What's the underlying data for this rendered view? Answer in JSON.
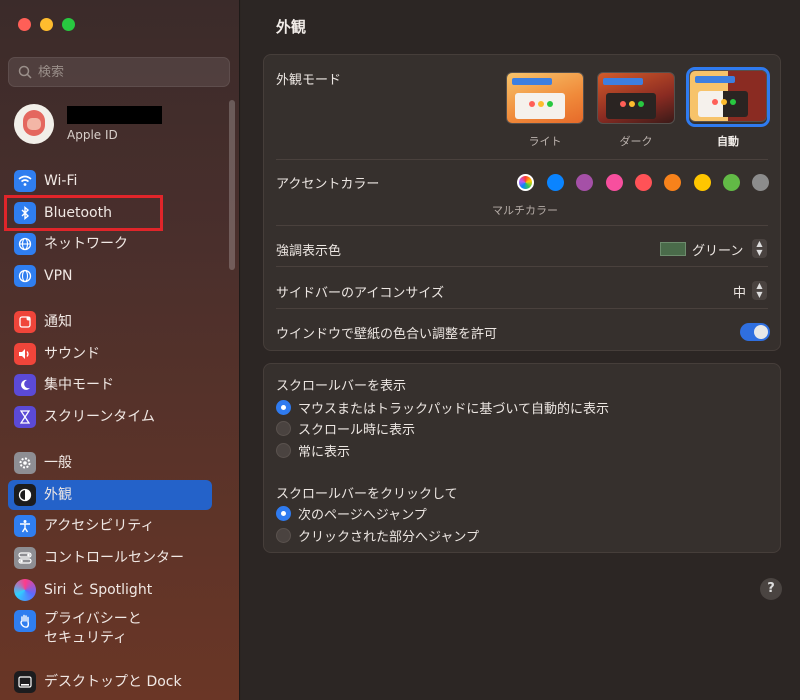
{
  "search": {
    "placeholder": "検索"
  },
  "account": {
    "subtitle": "Apple ID"
  },
  "sidebar": {
    "items": [
      {
        "label": "Wi-Fi"
      },
      {
        "label": "Bluetooth"
      },
      {
        "label": "ネットワーク"
      },
      {
        "label": "VPN"
      },
      {
        "label": "通知"
      },
      {
        "label": "サウンド"
      },
      {
        "label": "集中モード"
      },
      {
        "label": "スクリーンタイム"
      },
      {
        "label": "一般"
      },
      {
        "label": "外観"
      },
      {
        "label": "アクセシビリティ"
      },
      {
        "label": "コントロールセンター"
      },
      {
        "label": "Siri と Spotlight"
      },
      {
        "label": "プライバシーと\nセキュリティ"
      },
      {
        "label": "デスクトップと Dock"
      }
    ]
  },
  "main": {
    "title": "外観",
    "appearance": {
      "label": "外観モード",
      "options": [
        {
          "label": "ライト"
        },
        {
          "label": "ダーク"
        },
        {
          "label": "自動"
        }
      ],
      "selected": "自動"
    },
    "accent": {
      "label": "アクセントカラー",
      "multicolor_label": "マルチカラー",
      "colors": [
        "#0a84ff",
        "#a550a7",
        "#f74f9e",
        "#ff5257",
        "#f7821b",
        "#ffc600",
        "#62ba46",
        "#8c8c8c"
      ]
    },
    "highlight": {
      "label": "強調表示色",
      "value": "グリーン"
    },
    "sidebar_icon_size": {
      "label": "サイドバーのアイコンサイズ",
      "value": "中"
    },
    "wallpaper_tint": {
      "label": "ウインドウで壁紙の色合い調整を許可",
      "enabled": true
    },
    "show_scrollbars": {
      "title": "スクロールバーを表示",
      "options": [
        {
          "label": "マウスまたはトラックパッドに基づいて自動的に表示",
          "selected": true
        },
        {
          "label": "スクロール時に表示",
          "selected": false
        },
        {
          "label": "常に表示",
          "selected": false
        }
      ]
    },
    "click_scrollbar": {
      "title": "スクロールバーをクリックして",
      "options": [
        {
          "label": "次のページへジャンプ",
          "selected": true
        },
        {
          "label": "クリックされた部分へジャンプ",
          "selected": false
        }
      ]
    },
    "help": "?"
  }
}
